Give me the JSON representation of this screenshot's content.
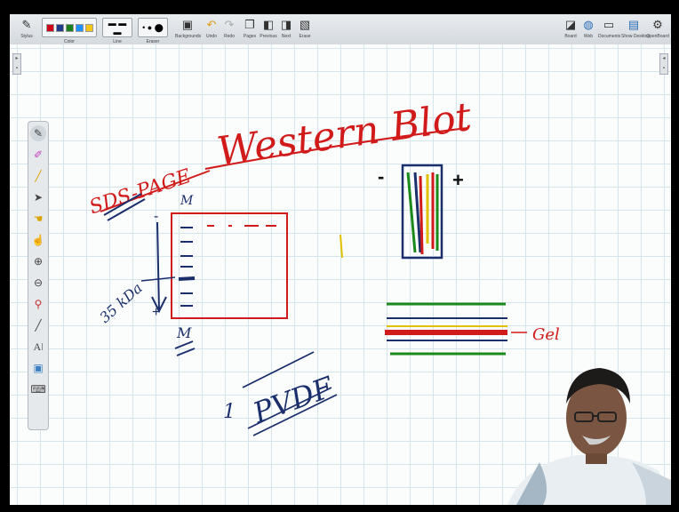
{
  "toolbar": {
    "stylus": "Stylus",
    "color": "Color",
    "line": "Line",
    "eraser": "Eraser",
    "backgrounds": "Backgrounds",
    "undo": "Undo",
    "redo": "Redo",
    "pages": "Pages",
    "previous": "Previous",
    "next": "Next",
    "erase": "Erase",
    "board": "Board",
    "web": "Web",
    "documents": "Documents",
    "show_desktop": "Show Desktop",
    "openboard": "OpenBoard",
    "colors": [
      "#d0021b",
      "#1e3a8a",
      "#1b7f1b",
      "#1e90ff",
      "#f5c518"
    ]
  },
  "sidebar": {
    "tools": [
      "pen-icon",
      "highlighter-icon",
      "marker-icon",
      "selector-icon",
      "hand-icon",
      "interact-icon",
      "zoom-in-icon",
      "zoom-out-icon",
      "laser-icon",
      "line-icon",
      "text-icon",
      "capture-icon",
      "keyboard-icon"
    ]
  },
  "whiteboard": {
    "title": "Western Blot",
    "sds_page": "SDS-PAGE",
    "kda": "35 kDa",
    "m_top": "M",
    "m_bottom": "M",
    "minus_gel": "-",
    "plus_gel": "+",
    "pvdf": "PVDF",
    "one": "1",
    "gel": "Gel",
    "minus": "-",
    "plus": "+"
  }
}
